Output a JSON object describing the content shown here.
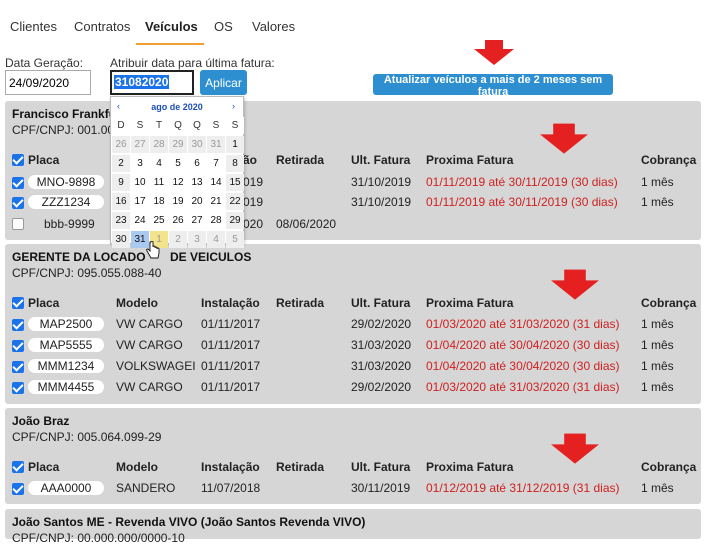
{
  "tabs": [
    "Clientes",
    "Contratos",
    "Veículos",
    "OS",
    "Valores"
  ],
  "form": {
    "date_label": "Data Geração:",
    "date_value": "24/09/2020",
    "assign_label": "Atribuir data para última fatura:",
    "assign_value": "31082020",
    "apply_button": "Aplicar",
    "update_button": "Atualizar veículos a mais de 2 meses sem fatura"
  },
  "calendar": {
    "month": "ago de 2020",
    "prev": "‹",
    "next": "›",
    "weekdays": [
      "D",
      "S",
      "T",
      "Q",
      "Q",
      "S",
      "S"
    ],
    "weeks": [
      [
        "26",
        "27",
        "28",
        "29",
        "30",
        "31",
        "1"
      ],
      [
        "2",
        "3",
        "4",
        "5",
        "6",
        "7",
        "8"
      ],
      [
        "9",
        "10",
        "11",
        "12",
        "13",
        "14",
        "15"
      ],
      [
        "16",
        "17",
        "18",
        "19",
        "20",
        "21",
        "22"
      ],
      [
        "23",
        "24",
        "25",
        "26",
        "27",
        "28",
        "29"
      ],
      [
        "30",
        "31",
        "1",
        "2",
        "3",
        "4",
        "5"
      ]
    ]
  },
  "headers": {
    "plate": "Placa",
    "model": "Modelo",
    "install": "Instalação",
    "withdrawal": "Retirada",
    "last": "Ult. Fatura",
    "next": "Proxima Fatura",
    "billing": "Cobrança"
  },
  "clients": [
    {
      "name": "Francisco Frankfu",
      "doc": "CPF/CNPJ: 001.00",
      "rows": [
        {
          "plate": "MNO-9898",
          "model": "",
          "install": "019",
          "withdrawal": "",
          "last": "31/10/2019",
          "next": "01/11/2019 até 30/11/2019 (30 dias)",
          "billing": "1 mês",
          "checked": true
        },
        {
          "plate": "ZZZ1234",
          "model": "",
          "install": "019",
          "withdrawal": "",
          "last": "31/10/2019",
          "next": "01/11/2019 até 30/11/2019 (30 dias)",
          "billing": "1 mês",
          "checked": true
        },
        {
          "plate": "bbb-9999",
          "model": "",
          "install": "020",
          "withdrawal": "08/06/2020",
          "last": "",
          "next": "",
          "billing": "",
          "checked": false
        }
      ]
    },
    {
      "name": "GERENTE DA LOCADO",
      "name_tail": "DE VEICULOS",
      "doc": "CPF/CNPJ: 095.055.088-40",
      "rows": [
        {
          "plate": "MAP2500",
          "model": "VW CARGO",
          "install": "01/11/2017",
          "withdrawal": "",
          "last": "29/02/2020",
          "next": "01/03/2020 até 31/03/2020 (31 dias)",
          "billing": "1 mês",
          "checked": true
        },
        {
          "plate": "MAP5555",
          "model": "VW CARGO",
          "install": "01/11/2017",
          "withdrawal": "",
          "last": "31/03/2020",
          "next": "01/04/2020 até 30/04/2020 (30 dias)",
          "billing": "1 mês",
          "checked": true
        },
        {
          "plate": "MMM1234",
          "model": "VOLKSWAGEI",
          "install": "01/11/2017",
          "withdrawal": "",
          "last": "31/03/2020",
          "next": "01/04/2020 até 30/04/2020 (30 dias)",
          "billing": "1 mês",
          "checked": true
        },
        {
          "plate": "MMM4455",
          "model": "VW CARGO",
          "install": "01/11/2017",
          "withdrawal": "",
          "last": "29/02/2020",
          "next": "01/03/2020 até 31/03/2020 (31 dias)",
          "billing": "1 mês",
          "checked": true
        }
      ]
    },
    {
      "name": "João Braz",
      "doc": "CPF/CNPJ: 005.064.099-29",
      "rows": [
        {
          "plate": "AAA0000",
          "model": "SANDERO",
          "install": "11/07/2018",
          "withdrawal": "",
          "last": "30/11/2019",
          "next": "01/12/2019 até 31/12/2019 (31 dias)",
          "billing": "1 mês",
          "checked": true
        }
      ]
    },
    {
      "name": "João Santos ME - Revenda VIVO (João Santos Revenda VIVO)",
      "doc": "CPF/CNPJ: 00.000.000/0000-10",
      "rows": []
    }
  ]
}
